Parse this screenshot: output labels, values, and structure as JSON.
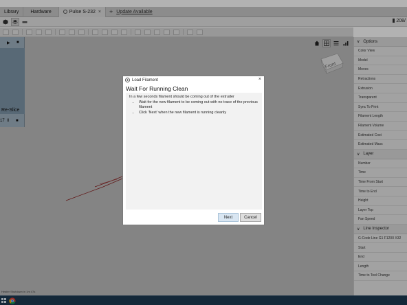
{
  "tabs": [
    {
      "label": "Library"
    },
    {
      "label": "Hardware"
    },
    {
      "label": "Pulse S-232",
      "close": "×"
    }
  ],
  "tabbar": {
    "add_label": "+",
    "update_link": "Update Available"
  },
  "counter": "208/",
  "left_panel": {
    "reslice_label": "Re-Slice",
    "controls": [
      "17",
      "II",
      "■"
    ]
  },
  "status_text": "Heater Shutdown in 1m 47s",
  "view_cube": {
    "face_label": "Front"
  },
  "right_panel": {
    "sections": [
      {
        "title": "Options",
        "items": [
          "Color View",
          "Model",
          "Moves",
          "Retractions",
          "Extrusion",
          "Transparent",
          "Sync To Print",
          "Filament Length",
          "Filament Volume",
          "Estimated Cost",
          "Estimated Mass"
        ]
      },
      {
        "title": "Layer",
        "items": [
          "Number",
          "Time",
          "Time From Start",
          "Time to End",
          "Height",
          "Layer Top",
          "Fan Speed"
        ]
      },
      {
        "title": "Line Inspector",
        "items": [
          "G-Code Line G1 F1200 X32",
          "Start",
          "End",
          "Length",
          "Time to Tool Change"
        ]
      }
    ]
  },
  "dialog": {
    "title": "Load Filament",
    "close": "×",
    "heading": "Wait For Running Clean",
    "intro": "In a few seconds filament should be coming out of the extruder",
    "bullets": [
      "Wait for the new filament to be coming out with no trace of the previous filament",
      "Click 'Next' when the new filament is running cleanly"
    ],
    "next_label": "Next",
    "cancel_label": "Cancel"
  },
  "colors": {
    "viewport_bg": "#bdbdbd",
    "taskbar": "#1d3a52",
    "toolpath": "#8b1f1f",
    "next_button": "#d9e6f2"
  }
}
